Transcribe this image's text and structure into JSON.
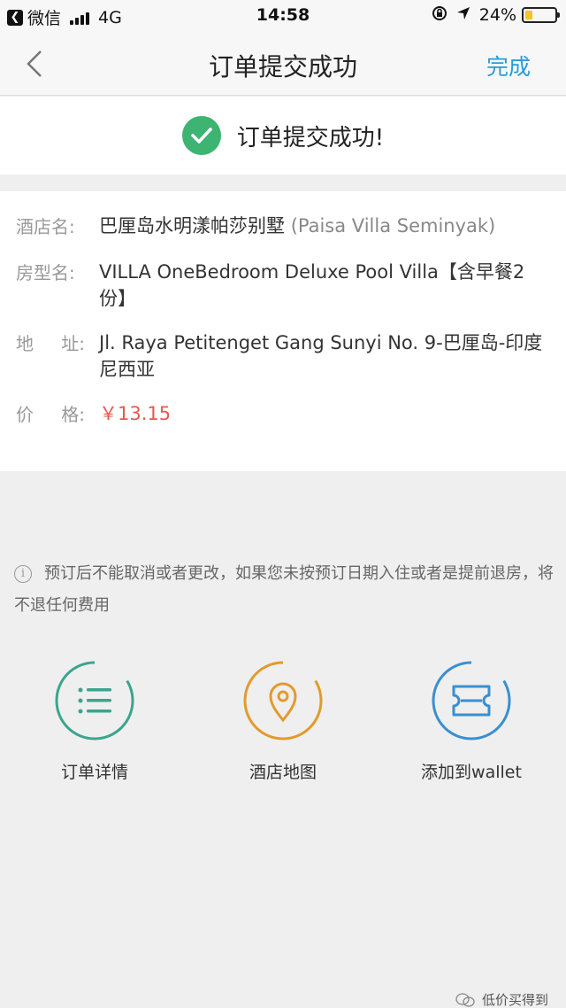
{
  "status_bar": {
    "app_back": "微信",
    "network": "4G",
    "time": "14:58",
    "battery": "24%",
    "battery_level": 0.24
  },
  "nav": {
    "title": "订单提交成功",
    "done": "完成"
  },
  "success": {
    "text": "订单提交成功!"
  },
  "order": {
    "hotel_label": "酒店名:",
    "hotel_name": "巴厘岛水明漾帕莎别墅",
    "hotel_name_en": "(Paisa Villa Seminyak)",
    "room_label": "房型名:",
    "room_type": "VILLA OneBedroom Deluxe Pool Villa【含早餐2份】",
    "address_label_a": "地",
    "address_label_b": "址",
    "address": "Jl. Raya Petitenget Gang Sunyi No. 9-巴厘岛-印度尼西亚",
    "price_label_a": "价",
    "price_label_b": "格",
    "price": "￥13.15"
  },
  "notice": "预订后不能取消或者更改，如果您未按预订日期入住或者是提前退房，将不退任何费用",
  "actions": [
    {
      "label": "订单详情",
      "icon": "list-icon",
      "color": "#3aa58c"
    },
    {
      "label": "酒店地图",
      "icon": "map-pin-icon",
      "color": "#e39a2c"
    },
    {
      "label": "添加到wallet",
      "icon": "ticket-icon",
      "color": "#3a8fd0"
    }
  ],
  "watermark": "低价买得到"
}
